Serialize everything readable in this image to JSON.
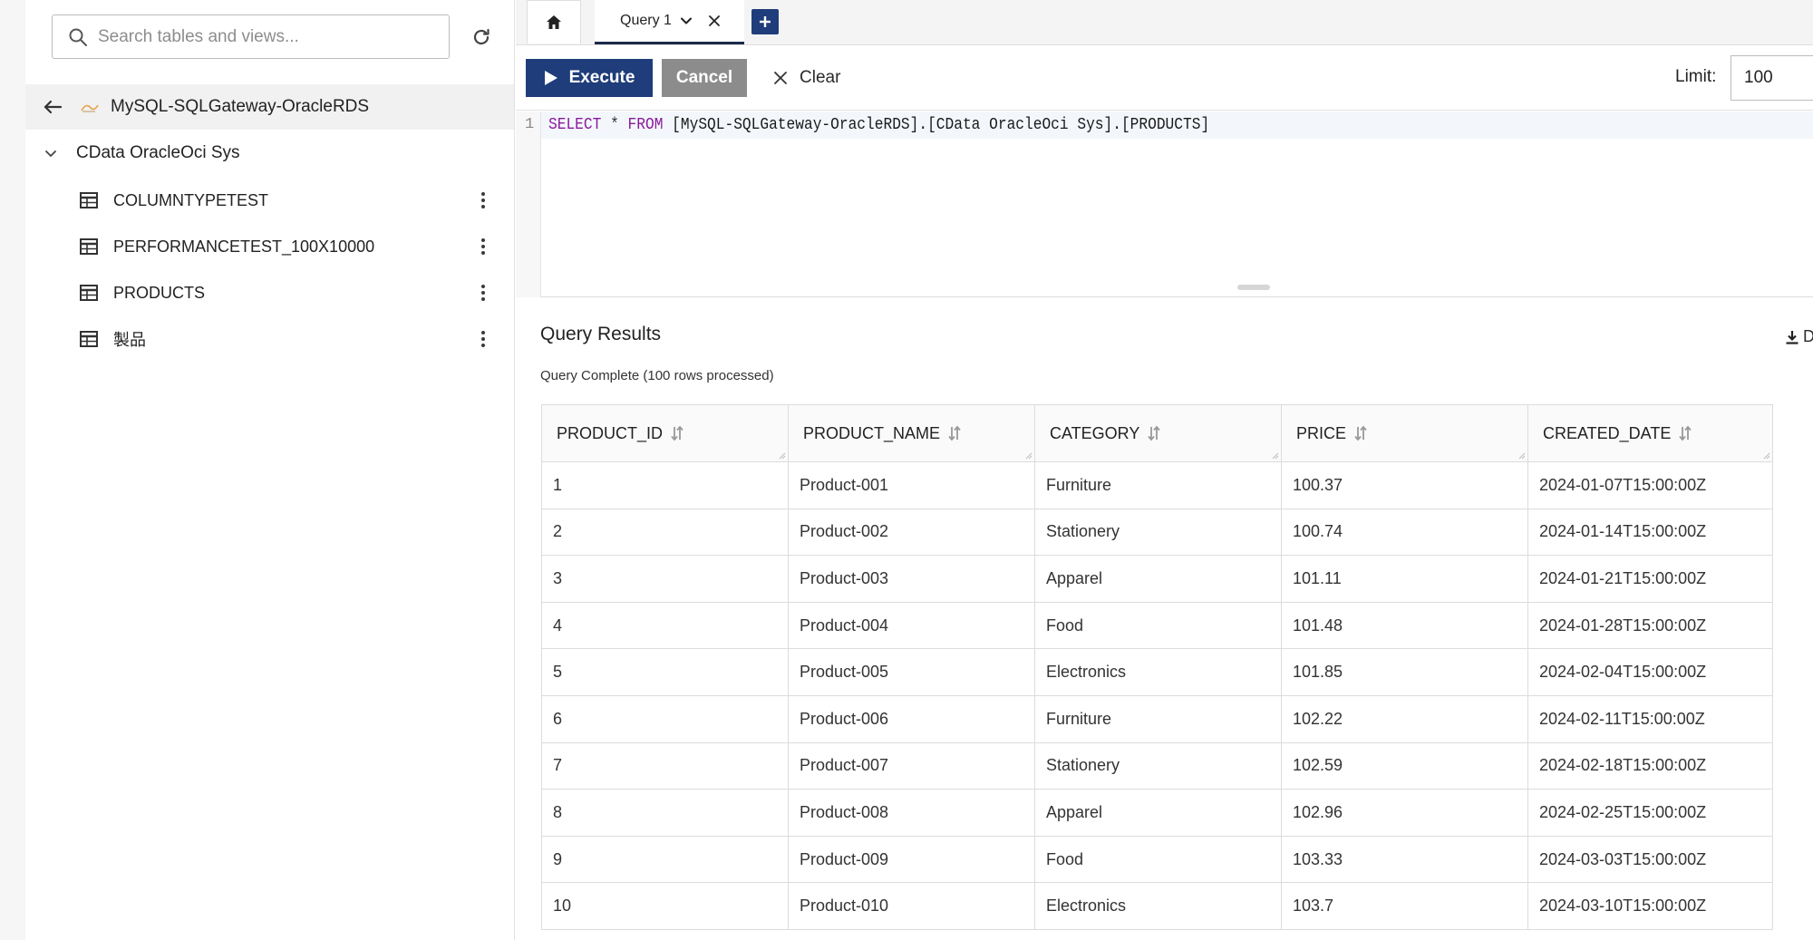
{
  "sidebar": {
    "search_placeholder": "Search tables and views...",
    "connection_name": "MySQL-SQLGateway-OracleRDS",
    "schema_name": "CData OracleOci Sys",
    "tables": [
      {
        "label": "COLUMNTYPETEST"
      },
      {
        "label": "PERFORMANCETEST_100X10000"
      },
      {
        "label": "PRODUCTS"
      },
      {
        "label": "製品"
      }
    ]
  },
  "tabs": {
    "query_tab_label": "Query 1"
  },
  "toolbar": {
    "execute_label": "Execute",
    "cancel_label": "Cancel",
    "clear_label": "Clear",
    "limit_label": "Limit:",
    "limit_value": "100"
  },
  "editor": {
    "line_number": "1",
    "kw_select": "SELECT",
    "star": "*",
    "kw_from": "FROM",
    "target": "[MySQL-SQLGateway-OracleRDS].[CData OracleOci Sys].[PRODUCTS]"
  },
  "results": {
    "title": "Query Results",
    "status": "Query Complete (100 rows processed)",
    "download_label": "D",
    "columns": [
      "PRODUCT_ID",
      "PRODUCT_NAME",
      "CATEGORY",
      "PRICE",
      "CREATED_DATE"
    ],
    "rows": [
      [
        "1",
        "Product-001",
        "Furniture",
        "100.37",
        "2024-01-07T15:00:00Z"
      ],
      [
        "2",
        "Product-002",
        "Stationery",
        "100.74",
        "2024-01-14T15:00:00Z"
      ],
      [
        "3",
        "Product-003",
        "Apparel",
        "101.11",
        "2024-01-21T15:00:00Z"
      ],
      [
        "4",
        "Product-004",
        "Food",
        "101.48",
        "2024-01-28T15:00:00Z"
      ],
      [
        "5",
        "Product-005",
        "Electronics",
        "101.85",
        "2024-02-04T15:00:00Z"
      ],
      [
        "6",
        "Product-006",
        "Furniture",
        "102.22",
        "2024-02-11T15:00:00Z"
      ],
      [
        "7",
        "Product-007",
        "Stationery",
        "102.59",
        "2024-02-18T15:00:00Z"
      ],
      [
        "8",
        "Product-008",
        "Apparel",
        "102.96",
        "2024-02-25T15:00:00Z"
      ],
      [
        "9",
        "Product-009",
        "Food",
        "103.33",
        "2024-03-03T15:00:00Z"
      ],
      [
        "10",
        "Product-010",
        "Electronics",
        "103.7",
        "2024-03-10T15:00:00Z"
      ]
    ]
  },
  "colors": {
    "primary": "#1f3d7a",
    "cancel_gray": "#8c8c8c",
    "sql_keyword": "#8a1a9c"
  }
}
